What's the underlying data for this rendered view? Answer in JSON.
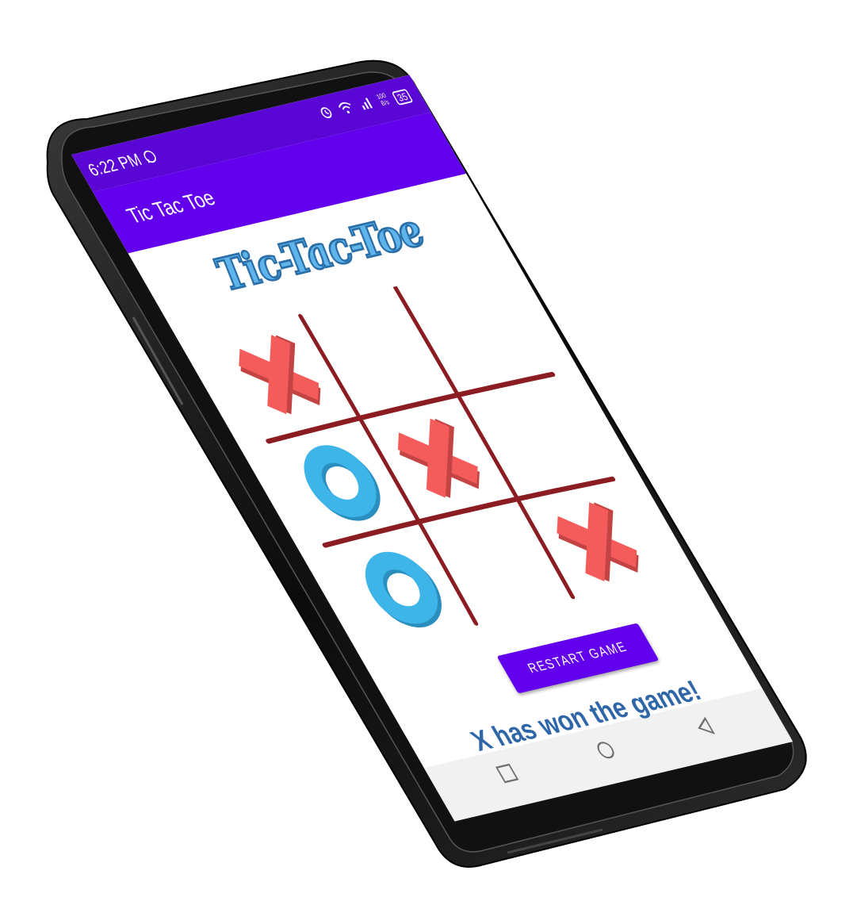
{
  "status_bar": {
    "time": "6:22 PM",
    "whatsapp_icon": "whatsapp-icon",
    "right_icons": [
      "alarm-icon",
      "wifi-icon",
      "signal-icon",
      "data-speed-icon",
      "battery-icon"
    ],
    "data_speed_top": "100",
    "data_speed_bottom": "B/s",
    "battery_level": "35"
  },
  "app_bar": {
    "title": "Tic Tac Toe"
  },
  "logo_text": "Tic-Tac-Toe",
  "board": {
    "cells": [
      "X",
      "",
      "",
      "O",
      "X",
      "",
      "O",
      "",
      "X"
    ]
  },
  "restart_label": "RESTART GAME",
  "result_text": "X has won the game!",
  "nav": {
    "recent": "square-icon",
    "home": "circle-icon",
    "back": "triangle-icon"
  },
  "colors": {
    "status_bar": "#5a06d4",
    "app_bar": "#6200ee",
    "button": "#6200ee",
    "x_mark": "#f45b5b",
    "o_mark": "#3db5e8",
    "grid": "#8b1d22",
    "result_text": "#2e66a8"
  }
}
